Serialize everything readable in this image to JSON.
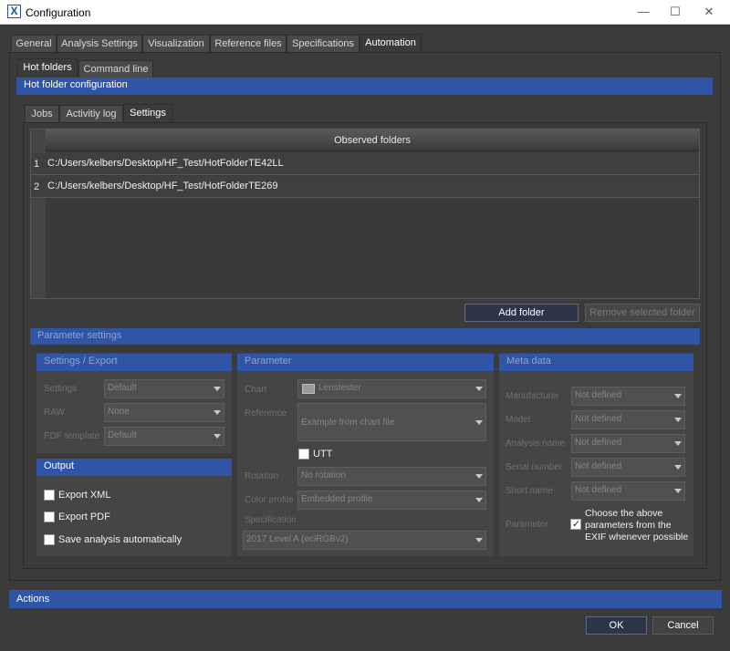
{
  "window": {
    "title": "Configuration",
    "minimize": "—",
    "maximize": "☐",
    "close": "✕"
  },
  "main_tabs": [
    "General",
    "Analysis Settings",
    "Visualization",
    "Reference files",
    "Specifications",
    "Automation"
  ],
  "sub_tabs": [
    "Hot folders",
    "Command line"
  ],
  "hot_folder_header": "Hot folder configuration",
  "inner_tabs": [
    "Jobs",
    "Activitiy log",
    "Settings"
  ],
  "observed_folders": {
    "header": "Observed folders",
    "rows": [
      {
        "index": "1",
        "path": "C:/Users/kelbers/Desktop/HF_Test/HotFolderTE42LL"
      },
      {
        "index": "2",
        "path": "C:/Users/kelbers/Desktop/HF_Test/HotFolderTE269"
      }
    ]
  },
  "folder_buttons": {
    "add": "Add folder",
    "remove": "Remove selected folder"
  },
  "parameter_settings": {
    "header": "Parameter settings",
    "settings_export": {
      "header": "Settings / Export",
      "settings_label": "Settings",
      "settings_value": "Default",
      "raw_label": "RAW",
      "raw_value": "None",
      "pdf_label": "PDF template",
      "pdf_value": "Default"
    },
    "output": {
      "header": "Output",
      "export_xml": "Export XML",
      "export_pdf": "Export PDF",
      "save_analysis": "Save analysis automatically"
    },
    "parameter": {
      "header": "Parameter",
      "chart_label": "Chart",
      "chart_value": "Lenstester",
      "reference_label": "Reference",
      "reference_value": "Example from chart file",
      "utt_label": "UTT",
      "rotation_label": "Rotation",
      "rotation_value": "No rotation",
      "color_profile_label": "Color profile",
      "color_profile_value": "Embedded profile",
      "specification_label": "Specification",
      "specification_value": "2017 Level A (eciRGBv2)"
    },
    "meta_data": {
      "header": "Meta data",
      "manufacturer_label": "Manufacturer",
      "manufacturer_value": "Not defined",
      "model_label": "Model",
      "model_value": "Not defined",
      "analysis_name_label": "Analysis name",
      "analysis_name_value": "Not defined",
      "serial_number_label": "Serial number",
      "serial_number_value": "Not defined",
      "short_name_label": "Short name",
      "short_name_value": "Not defined",
      "parameter_label": "Parameter",
      "exif_label_1": "Choose the above",
      "exif_label_2": "parameters from the",
      "exif_label_3": "EXIF whenever possible"
    }
  },
  "actions_header": "Actions",
  "dialog_buttons": {
    "ok": "OK",
    "cancel": "Cancel"
  },
  "colors": {
    "accent": "#3054a6",
    "background": "#3b3b3b",
    "panel": "#454545"
  },
  "icons": {
    "app": "app-x-icon",
    "chart": "chart-thumbnail-icon",
    "dropdown": "chevron-down-icon"
  }
}
